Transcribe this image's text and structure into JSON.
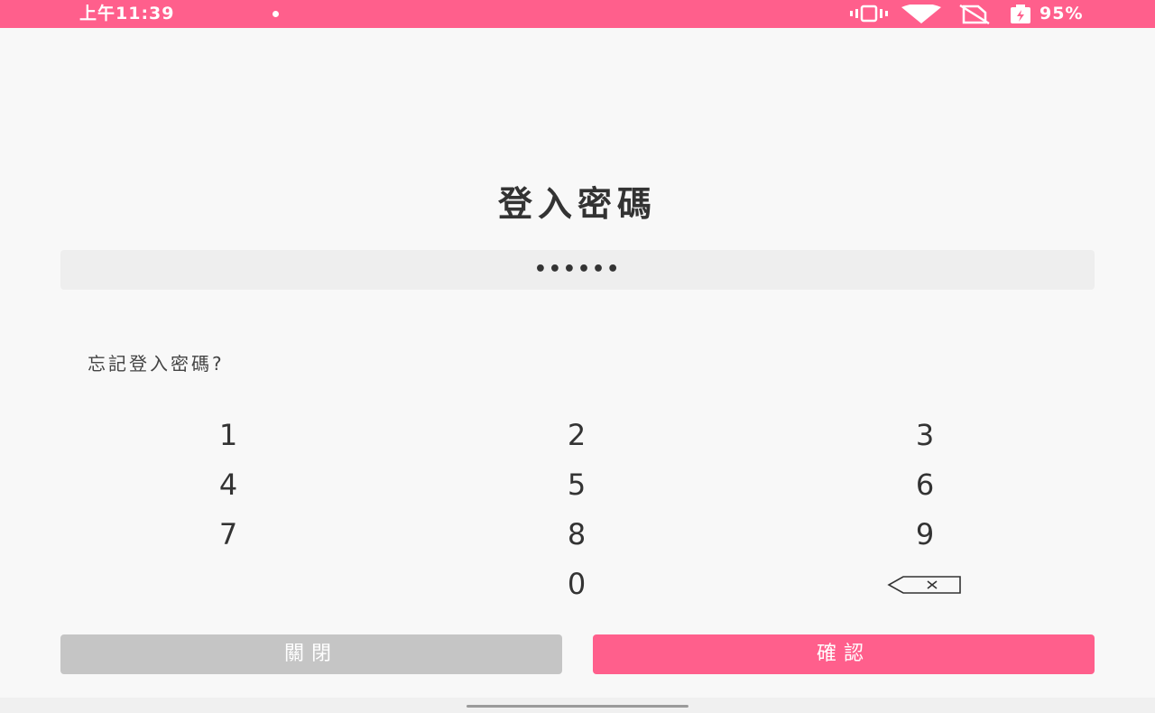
{
  "status_bar": {
    "time": "上午11:39",
    "battery": "95%",
    "icons": [
      "vibrate-icon",
      "wifi-icon",
      "no-sim-icon",
      "battery-icon"
    ],
    "color": "#ff5f8c"
  },
  "title": "登入密碼",
  "password_field": {
    "value": "••••••"
  },
  "forgot_link": "忘記登入密碼?",
  "keypad": {
    "keys": [
      "1",
      "2",
      "3",
      "4",
      "5",
      "6",
      "7",
      "8",
      "9",
      "0"
    ],
    "backspace_icon": "backspace-icon"
  },
  "buttons": {
    "close_label": "關閉",
    "confirm_label": "確認"
  },
  "colors": {
    "accent": "#ff5f8c",
    "disabled": "#c5c5c5",
    "text": "#333333"
  }
}
